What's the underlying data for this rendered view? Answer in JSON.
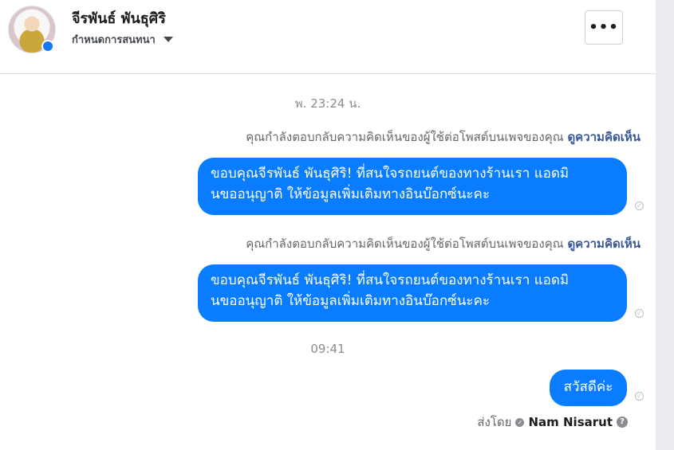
{
  "header": {
    "contact_name": "จีรพันธ์ พันธุศิริ",
    "assign_label": "กำหนดการสนทนา",
    "more_label": "•••"
  },
  "thread": {
    "timestamp_1": "พ. 23:24 น.",
    "notice_1": "คุณกำลังตอบกลับความคิดเห็นของผู้ใช้ต่อโพสต์บนเพจของคุณ",
    "notice_1_link": "ดูความคิดเห็น",
    "message_1_line1": "ขอบคุณจีรพันธ์ พันธุศิริ! ที่สนใจรถยนต์ของทางร้านเรา แอดมิ",
    "message_1_line2": "นขออนุญาติ ให้ข้อมูลเพิ่มเติมทางอินบ๊อกซ์นะคะ",
    "notice_2": "คุณกำลังตอบกลับความคิดเห็นของผู้ใช้ต่อโพสต์บนเพจของคุณ",
    "notice_2_link": "ดูความคิดเห็น",
    "message_2_line1": "ขอบคุณจีรพันธ์ พันธุศิริ! ที่สนใจรถยนต์ของทางร้านเรา แอดมิ",
    "message_2_line2": "นขออนุญาติ ให้ข้อมูลเพิ่มเติมทางอินบ๊อกซ์นะคะ",
    "timestamp_2": "09:41",
    "message_3": "สวัสดีค่ะ",
    "sent_by_label": "ส่งโดย",
    "sent_by_name": "Nam Nisarut"
  },
  "colors": {
    "bubble": "#0a7cff",
    "link": "#385898"
  },
  "icons": {
    "more": "more-icon",
    "assign": "caret-down-icon",
    "seen": "seen-check-icon",
    "verified": "verified-icon",
    "help": "help-icon"
  }
}
